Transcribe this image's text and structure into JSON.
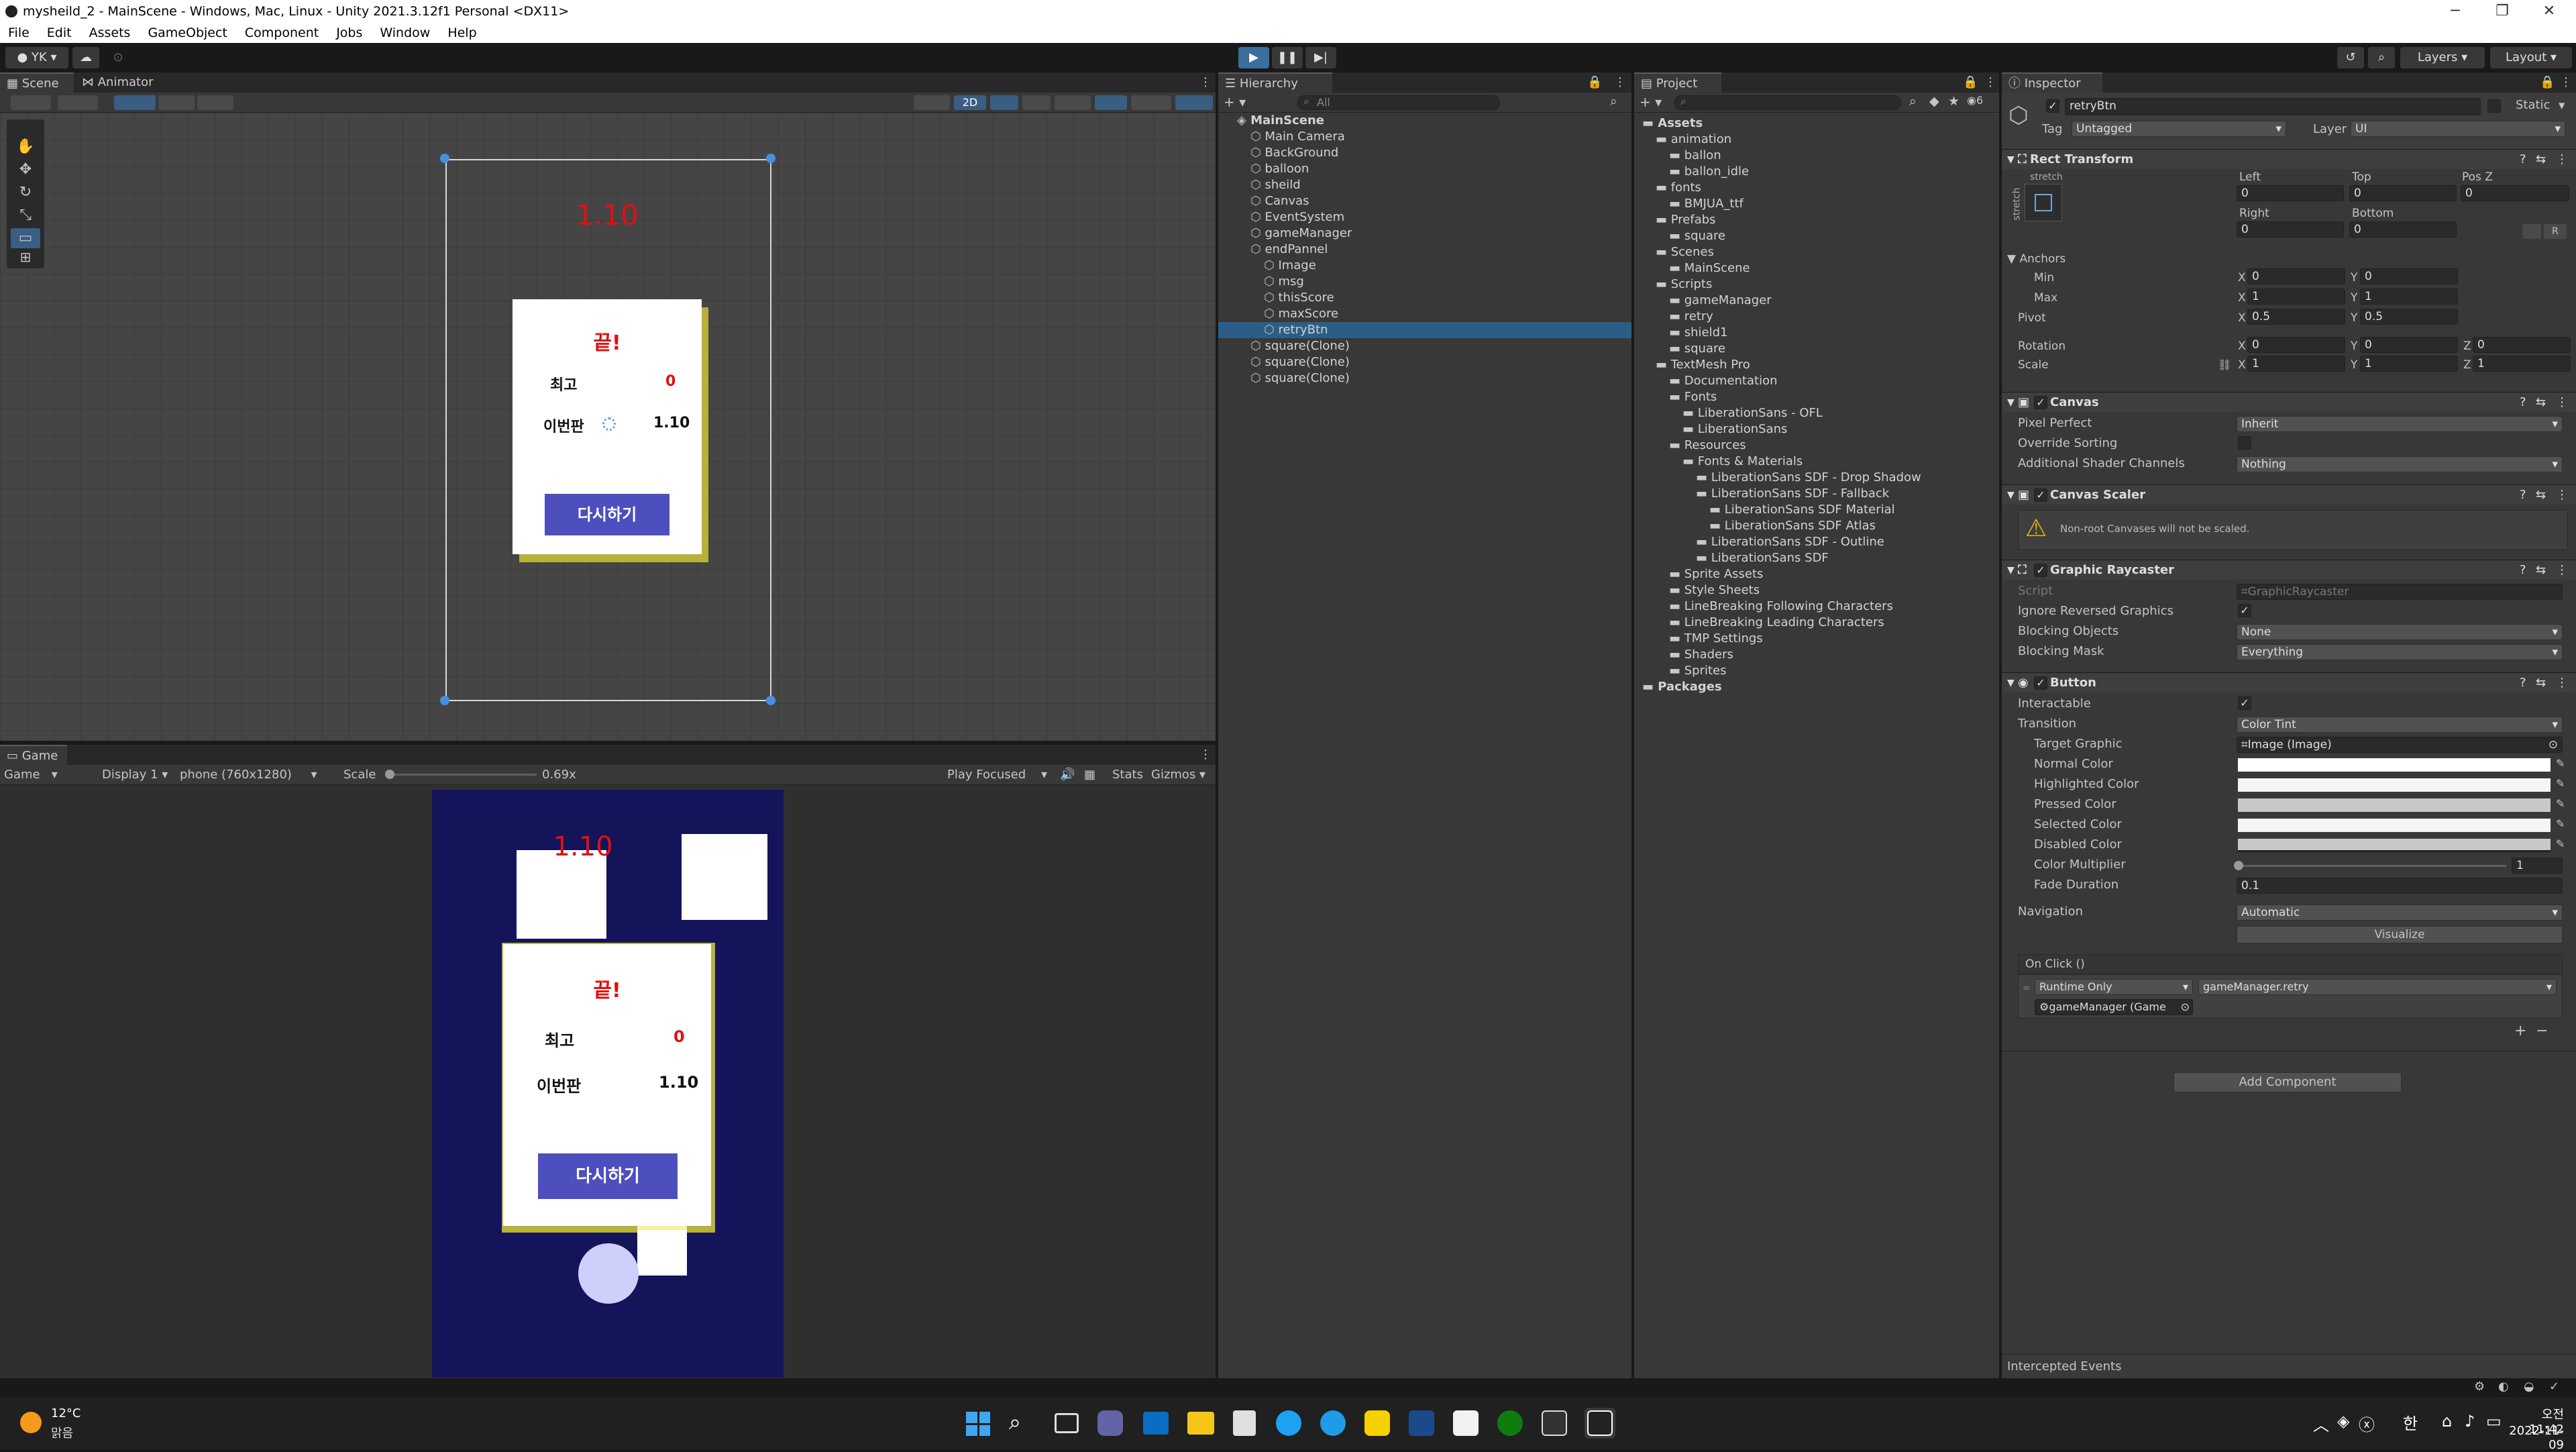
{
  "window": {
    "title": "mysheild_2 - MainScene - Windows, Mac, Linux - Unity 2021.3.12f1 Personal <DX11>"
  },
  "menu": [
    "File",
    "Edit",
    "Assets",
    "GameObject",
    "Component",
    "Jobs",
    "Window",
    "Help"
  ],
  "toolbar": {
    "account": "YK",
    "layers": "Layers",
    "layout": "Layout"
  },
  "scene": {
    "tabs": [
      "Scene",
      "Animator"
    ],
    "mode_2d": "2D",
    "score_text": "1.10",
    "popup": {
      "title": "끝!",
      "best_label": "최고",
      "best_value": "0",
      "current_label": "이번판",
      "current_value": "1.10",
      "retry_label": "다시하기"
    }
  },
  "game": {
    "tab": "Game",
    "display_dropdown": "Game",
    "display": "Display 1",
    "resolution": "phone (760x1280)",
    "scale_label": "Scale",
    "scale_value": "0.69x",
    "play_focused": "Play Focused",
    "stats": "Stats",
    "gizmos": "Gizmos",
    "score_text": "1.10",
    "popup": {
      "title": "끝!",
      "best_label": "최고",
      "best_value": "0",
      "current_label": "이번판",
      "current_value": "1.10",
      "retry_label": "다시하기"
    }
  },
  "hierarchy": {
    "tab": "Hierarchy",
    "search_placeholder": "All",
    "items": [
      {
        "label": "MainScene",
        "depth": 0,
        "bold": true
      },
      {
        "label": "Main Camera",
        "depth": 1
      },
      {
        "label": "BackGround",
        "depth": 1
      },
      {
        "label": "balloon",
        "depth": 1
      },
      {
        "label": "sheild",
        "depth": 1
      },
      {
        "label": "Canvas",
        "depth": 1
      },
      {
        "label": "EventSystem",
        "depth": 1
      },
      {
        "label": "gameManager",
        "depth": 1
      },
      {
        "label": "endPannel",
        "depth": 1
      },
      {
        "label": "Image",
        "depth": 2
      },
      {
        "label": "msg",
        "depth": 2
      },
      {
        "label": "thisScore",
        "depth": 2
      },
      {
        "label": "maxScore",
        "depth": 2
      },
      {
        "label": "retryBtn",
        "depth": 2,
        "selected": true
      },
      {
        "label": "square(Clone)",
        "depth": 1
      },
      {
        "label": "square(Clone)",
        "depth": 1
      },
      {
        "label": "square(Clone)",
        "depth": 1
      }
    ]
  },
  "project": {
    "tab": "Project",
    "badge": "6",
    "items": [
      {
        "label": "Assets",
        "depth": 0,
        "bold": true
      },
      {
        "label": "animation",
        "depth": 1
      },
      {
        "label": "ballon",
        "depth": 2
      },
      {
        "label": "ballon_idle",
        "depth": 2
      },
      {
        "label": "fonts",
        "depth": 1
      },
      {
        "label": "BMJUA_ttf",
        "depth": 2
      },
      {
        "label": "Prefabs",
        "depth": 1
      },
      {
        "label": "square",
        "depth": 2
      },
      {
        "label": "Scenes",
        "depth": 1
      },
      {
        "label": "MainScene",
        "depth": 2
      },
      {
        "label": "Scripts",
        "depth": 1
      },
      {
        "label": "gameManager",
        "depth": 2
      },
      {
        "label": "retry",
        "depth": 2
      },
      {
        "label": "shield1",
        "depth": 2
      },
      {
        "label": "square",
        "depth": 2
      },
      {
        "label": "TextMesh Pro",
        "depth": 1
      },
      {
        "label": "Documentation",
        "depth": 2
      },
      {
        "label": "Fonts",
        "depth": 2
      },
      {
        "label": "LiberationSans - OFL",
        "depth": 3
      },
      {
        "label": "LiberationSans",
        "depth": 3
      },
      {
        "label": "Resources",
        "depth": 2
      },
      {
        "label": "Fonts & Materials",
        "depth": 3
      },
      {
        "label": "LiberationSans SDF - Drop Shadow",
        "depth": 4
      },
      {
        "label": "LiberationSans SDF - Fallback",
        "depth": 4
      },
      {
        "label": "LiberationSans SDF Material",
        "depth": 5
      },
      {
        "label": "LiberationSans SDF Atlas",
        "depth": 5
      },
      {
        "label": "LiberationSans SDF - Outline",
        "depth": 4
      },
      {
        "label": "LiberationSans SDF",
        "depth": 4
      },
      {
        "label": "Sprite Assets",
        "depth": 2
      },
      {
        "label": "Style Sheets",
        "depth": 2
      },
      {
        "label": "LineBreaking Following Characters",
        "depth": 2
      },
      {
        "label": "LineBreaking Leading Characters",
        "depth": 2
      },
      {
        "label": "TMP Settings",
        "depth": 2
      },
      {
        "label": "Shaders",
        "depth": 2
      },
      {
        "label": "Sprites",
        "depth": 2
      },
      {
        "label": "Packages",
        "depth": 0,
        "bold": true
      }
    ]
  },
  "inspector": {
    "tab": "Inspector",
    "object_name": "retryBtn",
    "static_label": "Static",
    "tag_label": "Tag",
    "tag_value": "Untagged",
    "layer_label": "Layer",
    "layer_value": "UI",
    "rect_transform": {
      "header": "Rect Transform",
      "stretch": "stretch",
      "left_label": "Left",
      "left": "0",
      "top_label": "Top",
      "top": "0",
      "posz_label": "Pos Z",
      "posz": "0",
      "right_label": "Right",
      "right": "0",
      "bottom_label": "Bottom",
      "bottom": "0",
      "anchors_label": "Anchors",
      "min_label": "Min",
      "min_x": "0",
      "min_y": "0",
      "max_label": "Max",
      "max_x": "1",
      "max_y": "1",
      "pivot_label": "Pivot",
      "pivot_x": "0.5",
      "pivot_y": "0.5",
      "rotation_label": "Rotation",
      "rot_x": "0",
      "rot_y": "0",
      "rot_z": "0",
      "scale_label": "Scale",
      "scale_x": "1",
      "scale_y": "1",
      "scale_z": "1",
      "r_button": "R"
    },
    "canvas": {
      "header": "Canvas",
      "pixel_perfect_label": "Pixel Perfect",
      "pixel_perfect": "Inherit",
      "override_sorting_label": "Override Sorting",
      "shader_channels_label": "Additional Shader Channels",
      "shader_channels": "Nothing"
    },
    "canvas_scaler": {
      "header": "Canvas Scaler",
      "warning": "Non-root Canvases will not be scaled."
    },
    "graphic_raycaster": {
      "header": "Graphic Raycaster",
      "script_label": "Script",
      "script": "GraphicRaycaster",
      "ignore_reversed_label": "Ignore Reversed Graphics",
      "blocking_objects_label": "Blocking Objects",
      "blocking_objects": "None",
      "blocking_mask_label": "Blocking Mask",
      "blocking_mask": "Everything"
    },
    "button": {
      "header": "Button",
      "interactable_label": "Interactable",
      "transition_label": "Transition",
      "transition": "Color Tint",
      "target_graphic_label": "Target Graphic",
      "target_graphic": "Image (Image)",
      "normal_color_label": "Normal Color",
      "highlighted_color_label": "Highlighted Color",
      "pressed_color_label": "Pressed Color",
      "selected_color_label": "Selected Color",
      "disabled_color_label": "Disabled Color",
      "color_multiplier_label": "Color Multiplier",
      "color_multiplier": "1",
      "fade_duration_label": "Fade Duration",
      "fade_duration": "0.1",
      "navigation_label": "Navigation",
      "navigation": "Automatic",
      "visualize_label": "Visualize",
      "onclick_label": "On Click ()",
      "runtime": "Runtime Only",
      "function": "gameManager.retry",
      "target_object": "gameManager (Game",
      "plus": "+",
      "minus": "−"
    },
    "add_component": "Add Component",
    "intercepted_events": "Intercepted Events"
  },
  "taskbar": {
    "temperature": "12°C",
    "weather": "맑음",
    "ime": "한",
    "time": "오전 11:42",
    "date": "2022-11-09"
  },
  "colors": {
    "accent": "#4d4fbf",
    "game_bg": "#14145a",
    "score_red": "#e01010",
    "popup_shadow": "#b8b13a",
    "selected_row": "#2c5d87"
  }
}
